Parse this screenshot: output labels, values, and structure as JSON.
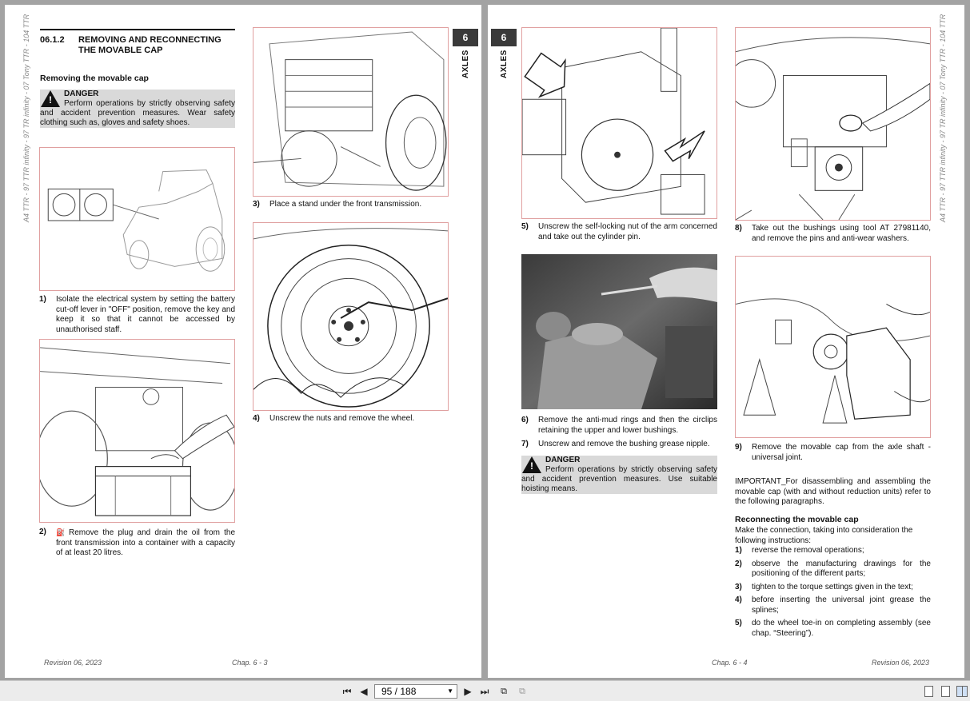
{
  "viewer": {
    "page_indicator": "95 / 188"
  },
  "left_page": {
    "side_text": "A4 TTR - 97 TTR infinity - 97 TR infinity - 07 Tony TTR - 104 TTR",
    "section_number": "06.1.2",
    "section_title": "REMOVING AND RECONNECTING THE MOVABLE CAP",
    "subheading": "Removing the movable cap",
    "danger": {
      "title": "DANGER",
      "body": "Perform operations by strictly observing safety and accident prevention measures. Wear safety clothing such as, gloves and safety shoes."
    },
    "steps": [
      {
        "num": "1)",
        "text": "Isolate the electrical system by setting the battery cut-off lever in \"OFF\" position, remove the key and keep it so that it cannot be accessed by unauthorised staff."
      },
      {
        "num": "2)",
        "text": "Remove the plug and drain the oil from the front transmission into a container with a capacity of at least 20 litres."
      },
      {
        "num": "3)",
        "text": "Place a stand under the front transmission."
      },
      {
        "num": "4)",
        "text": "Unscrew the nuts and remove the wheel."
      }
    ],
    "tab_number": "6",
    "tab_label": "AXLES",
    "footer_revision": "Revision 06, 2023",
    "footer_chap": "Chap. 6 - 3"
  },
  "right_page": {
    "side_text": "A4 TTR - 97 TTR infinity - 97 TR infinity - 07 Tony TTR - 104 TTR",
    "tab_number": "6",
    "tab_label": "AXLES",
    "steps": [
      {
        "num": "5)",
        "text": "Unscrew the self-locking nut of the arm concerned and take out the cylinder pin."
      },
      {
        "num": "6)",
        "text": "Remove the anti-mud rings and then the circlips retaining the upper and lower bushings."
      },
      {
        "num": "7)",
        "text": "Unscrew and remove the bushing grease nipple."
      },
      {
        "num": "8)",
        "text": "Take out the bushings using tool AT 27981140, and remove the pins and anti-wear washers."
      },
      {
        "num": "9)",
        "text": "Remove the movable cap from the axle shaft - universal joint."
      }
    ],
    "danger": {
      "title": "DANGER",
      "body": "Perform operations by strictly observing safety and accident prevention measures. Use suitable hoisting means."
    },
    "important": "IMPORTANT_For disassembling and assembling the movable cap (with and without reduction units) refer to the following paragraphs.",
    "reconnect_heading": "Reconnecting the movable cap",
    "reconnect_intro": "Make the connection, taking into consideration the following instructions:",
    "reconnect_steps": [
      {
        "num": "1)",
        "text": "reverse the removal operations;"
      },
      {
        "num": "2)",
        "text": "observe the manufacturing drawings for the positioning of the different parts;"
      },
      {
        "num": "3)",
        "text": "tighten to the torque settings given in the text;"
      },
      {
        "num": "4)",
        "text": "before inserting the universal joint grease the splines;"
      },
      {
        "num": "5)",
        "text": "do the wheel toe-in on completing assembly (see chap. “Steering”)."
      }
    ],
    "footer_chap": "Chap. 6 - 4",
    "footer_revision": "Revision 06, 2023"
  },
  "icons": {
    "first": "first-page-icon",
    "prev": "previous-page-icon",
    "next": "next-page-icon",
    "last": "last-page-icon",
    "rotate": "rotate-icon",
    "copy": "copy-icon",
    "single_view": "single-page-view-icon",
    "continuous_view": "continuous-view-icon",
    "two_page_view": "two-page-view-icon"
  }
}
